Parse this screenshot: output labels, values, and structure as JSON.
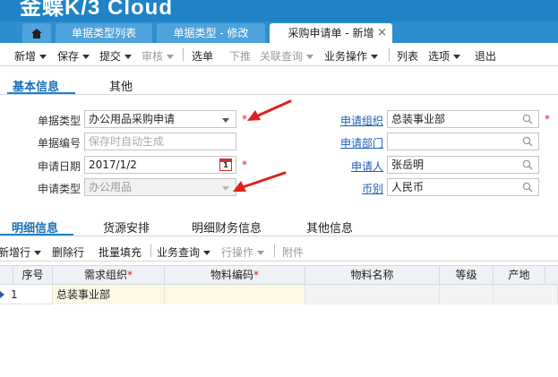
{
  "app": {
    "logo": "金蝶K/3 Cloud"
  },
  "tabs": [
    {
      "label": "单据类型列表"
    },
    {
      "label": "单据类型 - 修改"
    },
    {
      "label": "采购申请单 - 新增",
      "close": "×"
    }
  ],
  "toolbar": {
    "new": "新增",
    "save": "保存",
    "submit": "提交",
    "audit": "审核",
    "select_bill": "选单",
    "push_down": "下推",
    "related_query": "关联查询",
    "business_ops": "业务操作",
    "list": "列表",
    "options": "选项",
    "exit": "退出"
  },
  "header_tabs": {
    "basic": "基本信息",
    "other": "其他"
  },
  "form": {
    "bill_type": {
      "label": "单据类型",
      "value": "办公用品采购申请"
    },
    "bill_no": {
      "label": "单据编号",
      "placeholder": "保存时自动生成"
    },
    "apply_date": {
      "label": "申请日期",
      "value": "2017/1/2",
      "cal_day": "1"
    },
    "apply_type": {
      "label": "申请类型",
      "value": "办公用品"
    },
    "apply_org": {
      "label": "申请组织",
      "value": "总装事业部"
    },
    "apply_dept": {
      "label": "申请部门",
      "value": ""
    },
    "applicant": {
      "label": "申请人",
      "value": "张岳明"
    },
    "currency": {
      "label": "币别",
      "value": "人民币"
    },
    "required_mark": "*"
  },
  "detail_tabs": {
    "detail": "明细信息",
    "source": "货源安排",
    "finance": "明细财务信息",
    "other": "其他信息"
  },
  "detail_toolbar": {
    "add_row": "新增行",
    "delete_row": "删除行",
    "batch_fill": "批量填充",
    "business_query": "业务查询",
    "row_ops": "行操作",
    "attachment": "附件"
  },
  "grid": {
    "headers": {
      "seq": "序号",
      "demand_org": "需求组织",
      "material_code": "物料编码",
      "material_name": "物料名称",
      "grade": "等级",
      "origin": "产地"
    },
    "rows": [
      {
        "seq": "1",
        "demand_org": "总装事业部",
        "material_code": "",
        "material_name": "",
        "grade": "",
        "origin": ""
      }
    ]
  },
  "colors": {
    "brand": "#1f83c6",
    "arrow": "#e02020"
  }
}
